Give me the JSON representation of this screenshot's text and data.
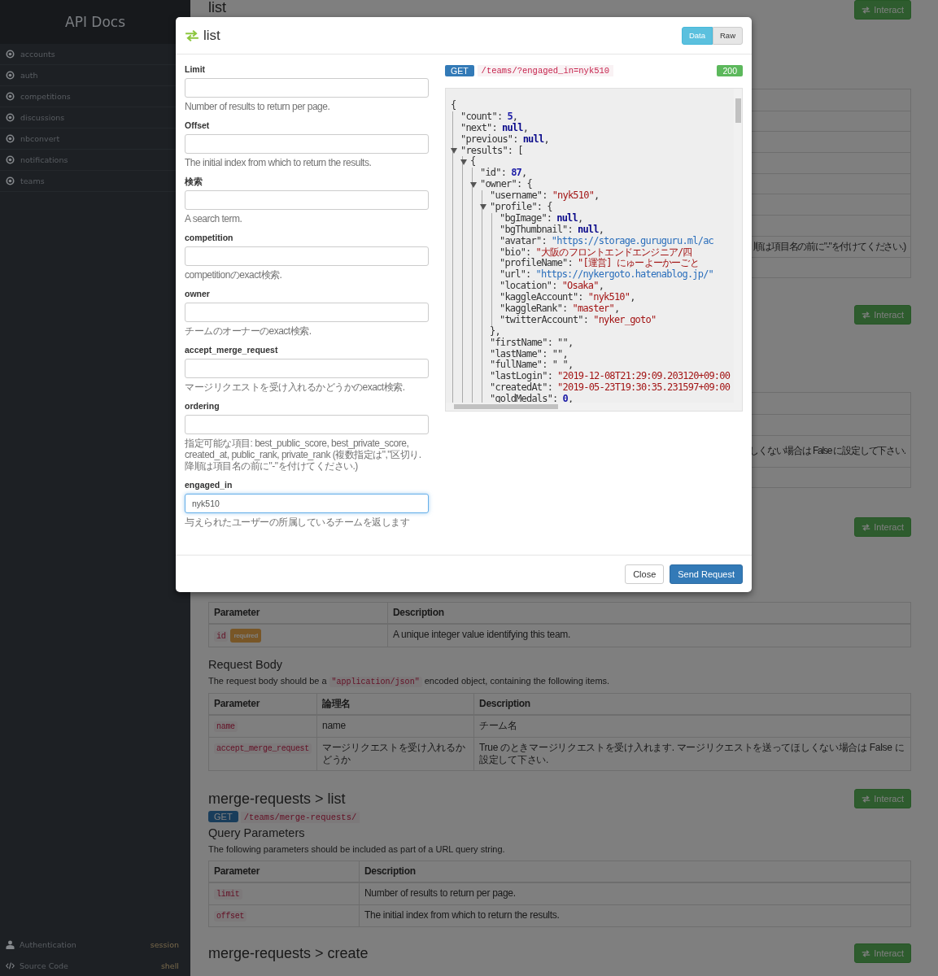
{
  "sidebar": {
    "title": "API Docs",
    "items": [
      {
        "label": "accounts"
      },
      {
        "label": "auth"
      },
      {
        "label": "competitions"
      },
      {
        "label": "discussions"
      },
      {
        "label": "nbconvert"
      },
      {
        "label": "notifications"
      },
      {
        "label": "teams"
      }
    ],
    "footer": [
      {
        "kind": "auth",
        "label": "Authentication",
        "value": "session"
      },
      {
        "kind": "source",
        "label": "Source Code",
        "value": "shell"
      }
    ]
  },
  "background": {
    "first": {
      "title": "list",
      "interact": "Interact",
      "rows": [
        {
          "kind": "blank"
        },
        {
          "kind": "blank"
        },
        {
          "kind": "blank"
        },
        {
          "kind": "blank"
        },
        {
          "kind": "blank"
        },
        {
          "kind": "blank"
        },
        {
          "kind": "blank"
        },
        {
          "kind": "text",
          "text": "順は項目名の前に\"-\"を付けてください.)"
        },
        {
          "kind": "blank"
        }
      ]
    },
    "second": {
      "interact": "Interact",
      "rows": [
        {
          "kind": "blank"
        },
        {
          "kind": "blank"
        },
        {
          "kind": "text",
          "text": "しくない場合は False に設定して下さい."
        },
        {
          "kind": "blank"
        }
      ]
    },
    "third": {
      "interact": "Interact",
      "path_table": {
        "columns": [
          "Parameter",
          "Description"
        ],
        "rows": [
          {
            "name": "id",
            "badge": "required",
            "description": "A unique integer value identifying this team."
          }
        ]
      },
      "body_heading": "Request Body",
      "body_text": [
        {
          "kind": "text",
          "text": "The request body should be a "
        },
        {
          "kind": "code",
          "text": "\"application/json\""
        },
        {
          "kind": "text",
          "text": " encoded object, containing the following items."
        }
      ],
      "body_table": {
        "columns": [
          "Parameter",
          "論理名",
          "Description"
        ],
        "rows": [
          {
            "name": "name",
            "logical": "name",
            "description": "チーム名"
          },
          {
            "name": "accept_merge_request",
            "logical": "マージリクエストを受け入れるかどうか",
            "description": "True のときマージリクエストを受け入れます. マージリクエストを送ってほしくない場合は False に設定して下さい."
          }
        ]
      }
    },
    "fourth": {
      "title": "merge-requests > list",
      "interact": "Interact",
      "method": "GET",
      "path": "/teams/merge-requests/",
      "query_heading": "Query Parameters",
      "query_text": "The following parameters should be included as part of a URL query string.",
      "table": {
        "columns": [
          "Parameter",
          "Description"
        ],
        "rows": [
          {
            "name": "limit",
            "description": "Number of results to return per page."
          },
          {
            "name": "offset",
            "description": "The initial index from which to return the results."
          }
        ]
      }
    },
    "fifth": {
      "title": "merge-requests > create",
      "interact": "Interact"
    }
  },
  "modal": {
    "title": "list",
    "view_toggle": [
      {
        "label": "Data",
        "selected": true
      },
      {
        "label": "Raw",
        "selected": false
      }
    ],
    "fields": [
      {
        "label": "Limit",
        "help": "Number of results to return per page.",
        "focused": false
      },
      {
        "label": "Offset",
        "help": "The initial index from which to return the results.",
        "focused": false
      },
      {
        "label": "検索",
        "help": "A search term.",
        "focused": false
      },
      {
        "label": "competition",
        "help": "competitionのexact検索.",
        "focused": false
      },
      {
        "label": "owner",
        "help": "チームのオーナーのexact検索.",
        "focused": false
      },
      {
        "label": "accept_merge_request",
        "help": "マージリクエストを受け入れるかどうかのexact検索.",
        "focused": false
      },
      {
        "label": "ordering",
        "help": "指定可能な項目: best_public_score, best_private_score, created_at, public_rank, private_rank (複数指定は\",\"区切り. 降順は項目名の前に\"-\"を付けてください.)",
        "focused": false
      },
      {
        "label": "engaged_in",
        "value": "nyk510",
        "help": "与えられたユーザーの所属しているチームを返します",
        "focused": true
      }
    ],
    "request": {
      "method": "GET",
      "path": "/teams/?engaged_in=nyk510",
      "status": "200"
    },
    "response": {
      "open": "{",
      "children": [
        {
          "key": "\"count\":",
          "value": "5",
          "kind": "number",
          "tail": ","
        },
        {
          "key": "\"next\":",
          "value": "null",
          "kind": "null",
          "tail": ","
        },
        {
          "key": "\"previous\":",
          "value": "null",
          "kind": "null",
          "tail": ","
        },
        {
          "key": "\"results\":",
          "open": "[",
          "expanded": true,
          "children": [
            {
              "open": "{",
              "expanded": true,
              "children": [
                {
                  "key": "\"id\":",
                  "value": "87",
                  "kind": "number",
                  "tail": ","
                },
                {
                  "key": "\"owner\":",
                  "open": "{",
                  "expanded": true,
                  "children": [
                    {
                      "key": "\"username\":",
                      "value": "\"nyk510\"",
                      "kind": "string",
                      "tail": ","
                    },
                    {
                      "key": "\"profile\":",
                      "open": "{",
                      "expanded": true,
                      "close": "},",
                      "children": [
                        {
                          "key": "\"bgImage\":",
                          "value": "null",
                          "kind": "null",
                          "tail": ","
                        },
                        {
                          "key": "\"bgThumbnail\":",
                          "value": "null",
                          "kind": "null",
                          "tail": ","
                        },
                        {
                          "key": "\"avatar\":",
                          "value": "\"https://storage.guruguru.ml/ac",
                          "kind": "link"
                        },
                        {
                          "key": "\"bio\":",
                          "value": "\"大阪のフロントエンドエンジニア/四",
                          "kind": "string"
                        },
                        {
                          "key": "\"profileName\":",
                          "value": "\"[運営] にゅーよーかーごと",
                          "kind": "string"
                        },
                        {
                          "key": "\"url\":",
                          "value": "\"https://nykergoto.hatenablog.jp/\"",
                          "kind": "link"
                        },
                        {
                          "key": "\"location\":",
                          "value": "\"Osaka\"",
                          "kind": "string",
                          "tail": ","
                        },
                        {
                          "key": "\"kaggleAccount\":",
                          "value": "\"nyk510\"",
                          "kind": "string",
                          "tail": ","
                        },
                        {
                          "key": "\"kaggleRank\":",
                          "value": "\"master\"",
                          "kind": "string",
                          "tail": ","
                        },
                        {
                          "key": "\"twitterAccount\":",
                          "value": "\"nyker_goto\"",
                          "kind": "string"
                        }
                      ]
                    },
                    {
                      "key": "\"firstName\":",
                      "value": "\"\"",
                      "kind": "plain",
                      "tail": ","
                    },
                    {
                      "key": "\"lastName\":",
                      "value": "\"\"",
                      "kind": "plain",
                      "tail": ","
                    },
                    {
                      "key": "\"fullName\":",
                      "value": "\" \"",
                      "kind": "plain",
                      "tail": ","
                    },
                    {
                      "key": "\"lastLogin\":",
                      "value": "\"2019-12-08T21:29:09.203120+09:00",
                      "kind": "string"
                    },
                    {
                      "key": "\"createdAt\":",
                      "value": "\"2019-05-23T19:30:35.231597+09:00",
                      "kind": "string"
                    },
                    {
                      "key": "\"goldMedals\":",
                      "value": "0",
                      "kind": "number",
                      "tail": ","
                    }
                  ]
                }
              ]
            }
          ]
        }
      ]
    },
    "buttons": [
      {
        "label": "Close",
        "kind": "default"
      },
      {
        "label": "Send Request",
        "kind": "primary"
      }
    ]
  }
}
